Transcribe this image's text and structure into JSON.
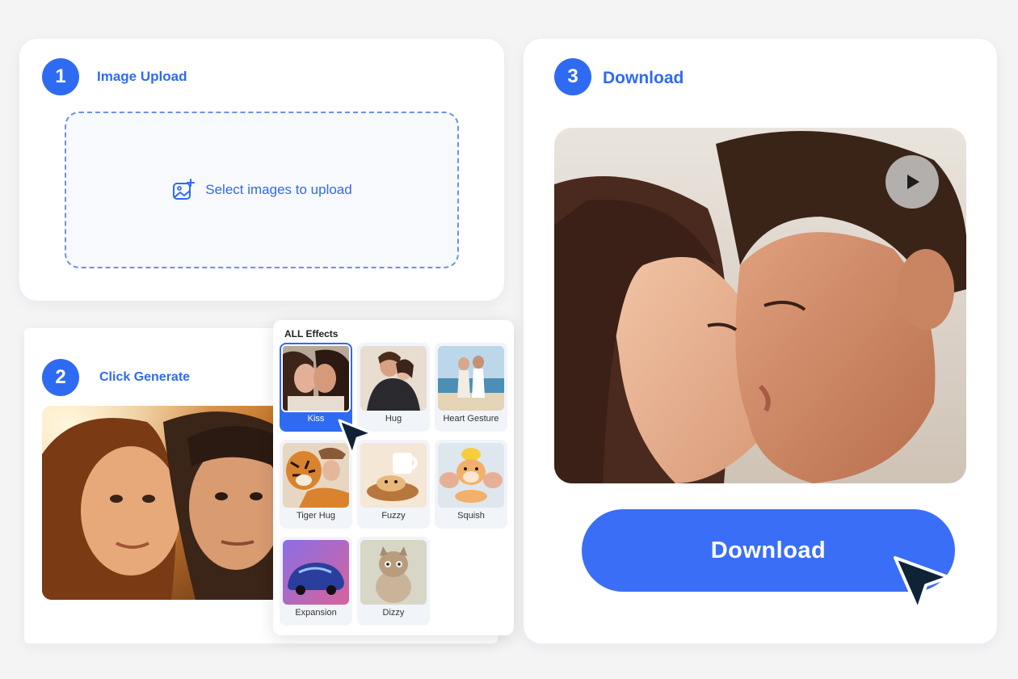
{
  "steps": {
    "upload": {
      "number": "1",
      "title": "Image Upload",
      "prompt": "Select images to upload",
      "icon": "image-add-icon"
    },
    "generate": {
      "number": "2",
      "title": "Click Generate"
    },
    "download": {
      "number": "3",
      "title": "Download",
      "button_label": "Download",
      "play_icon": "play-icon"
    }
  },
  "effects": {
    "title": "ALL Effects",
    "selected": "Kiss",
    "items": [
      {
        "label": "Kiss"
      },
      {
        "label": "Hug"
      },
      {
        "label": "Heart Gesture"
      },
      {
        "label": "Tiger Hug"
      },
      {
        "label": "Fuzzy"
      },
      {
        "label": "Squish"
      },
      {
        "label": "Expansion"
      },
      {
        "label": "Dizzy"
      }
    ]
  },
  "colors": {
    "accent": "#2f6bf2",
    "button": "#3a6ef7",
    "cursor": "#0f2236"
  }
}
